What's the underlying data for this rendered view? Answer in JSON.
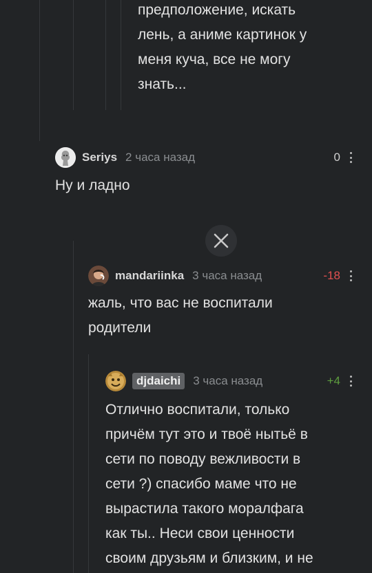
{
  "comments": [
    {
      "text": "предположение, искать\nлень, а аниме картинок у\nменя куча, все не могу\nзнать..."
    },
    {
      "username": "Seriys",
      "time": "2 часа назад",
      "rating": "0",
      "text": "Ну и ладно"
    },
    {
      "username": "mandariinka",
      "time": "3 часа назад",
      "rating": "-18",
      "text": "жаль, что вас не воспитали\nродители"
    },
    {
      "username": "djdaichi",
      "time": "3 часа назад",
      "rating": "+4",
      "text": "Отлично воспитали, только\nпричём тут это и твоё нытьё в\nсети по поводу вежливости в\nсети ?) спасибо маме что не\nвырастила такого моралфага\nкак ты.. Неси свои ценности\nсвоим друзьям и близким, и не"
    }
  ],
  "colors": {
    "background": "#222426",
    "rating_negative": "#e25050",
    "rating_positive": "#5e9e3f",
    "rating_neutral": "#cfcfcf"
  },
  "icons": {
    "close": "close-icon",
    "more": "more-vertical-icon"
  }
}
